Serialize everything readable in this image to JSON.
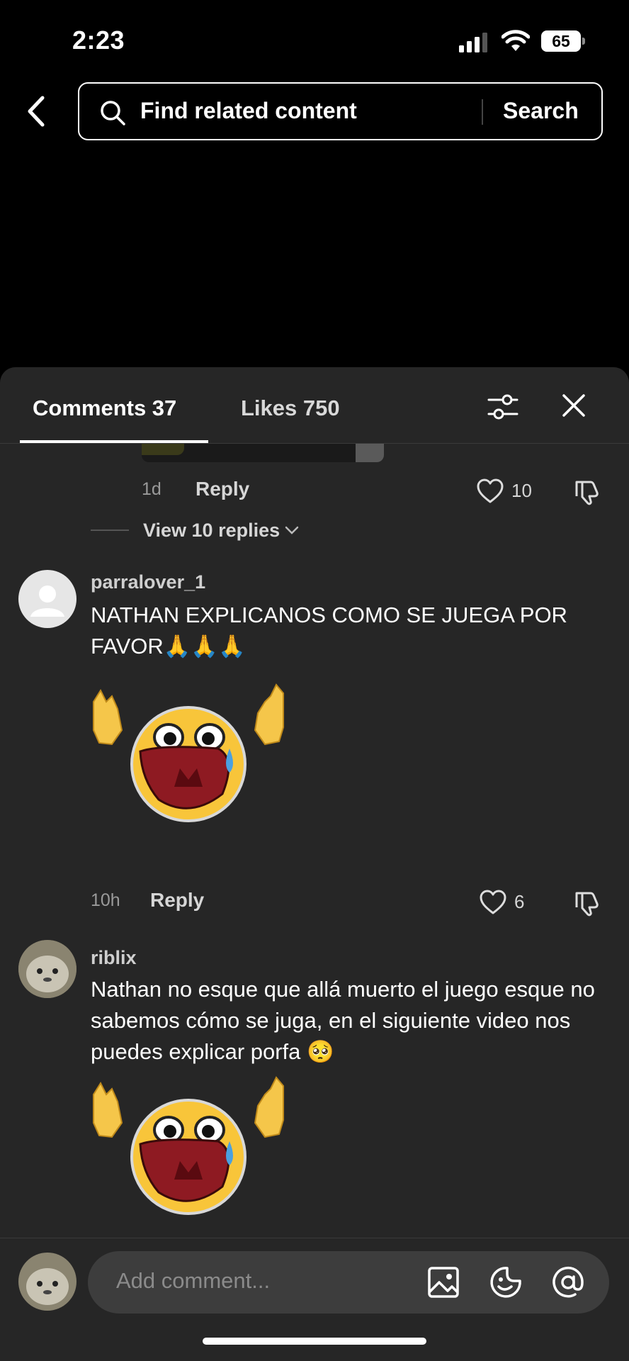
{
  "status_bar": {
    "time": "2:23",
    "battery": "65"
  },
  "search": {
    "placeholder": "Find related content",
    "button": "Search"
  },
  "tabs": {
    "comments": "Comments 37",
    "likes": "Likes 750"
  },
  "prev_comment": {
    "time": "1d",
    "reply": "Reply",
    "likes": "10",
    "view_replies": "View 10 replies"
  },
  "comments": [
    {
      "username": "parralover_1",
      "text": "NATHAN EXPLICANOS COMO SE JUEGA POR FAVOR🙏🙏🙏",
      "time": "10h",
      "reply": "Reply",
      "likes": "6",
      "sticker": "crying-face-sticker"
    },
    {
      "username": "riblix",
      "text": "Nathan no esque que allá muerto el juego esque no sabemos cómo se juga, en el siguiente video nos puedes explicar porfa 🥺",
      "sticker": "crying-face-sticker"
    }
  ],
  "composer": {
    "placeholder": "Add comment..."
  },
  "icons": [
    "back-arrow-icon",
    "search-icon",
    "filter-icon",
    "close-icon",
    "heart-icon",
    "dislike-icon",
    "image-icon",
    "emoji-icon",
    "mention-icon"
  ]
}
